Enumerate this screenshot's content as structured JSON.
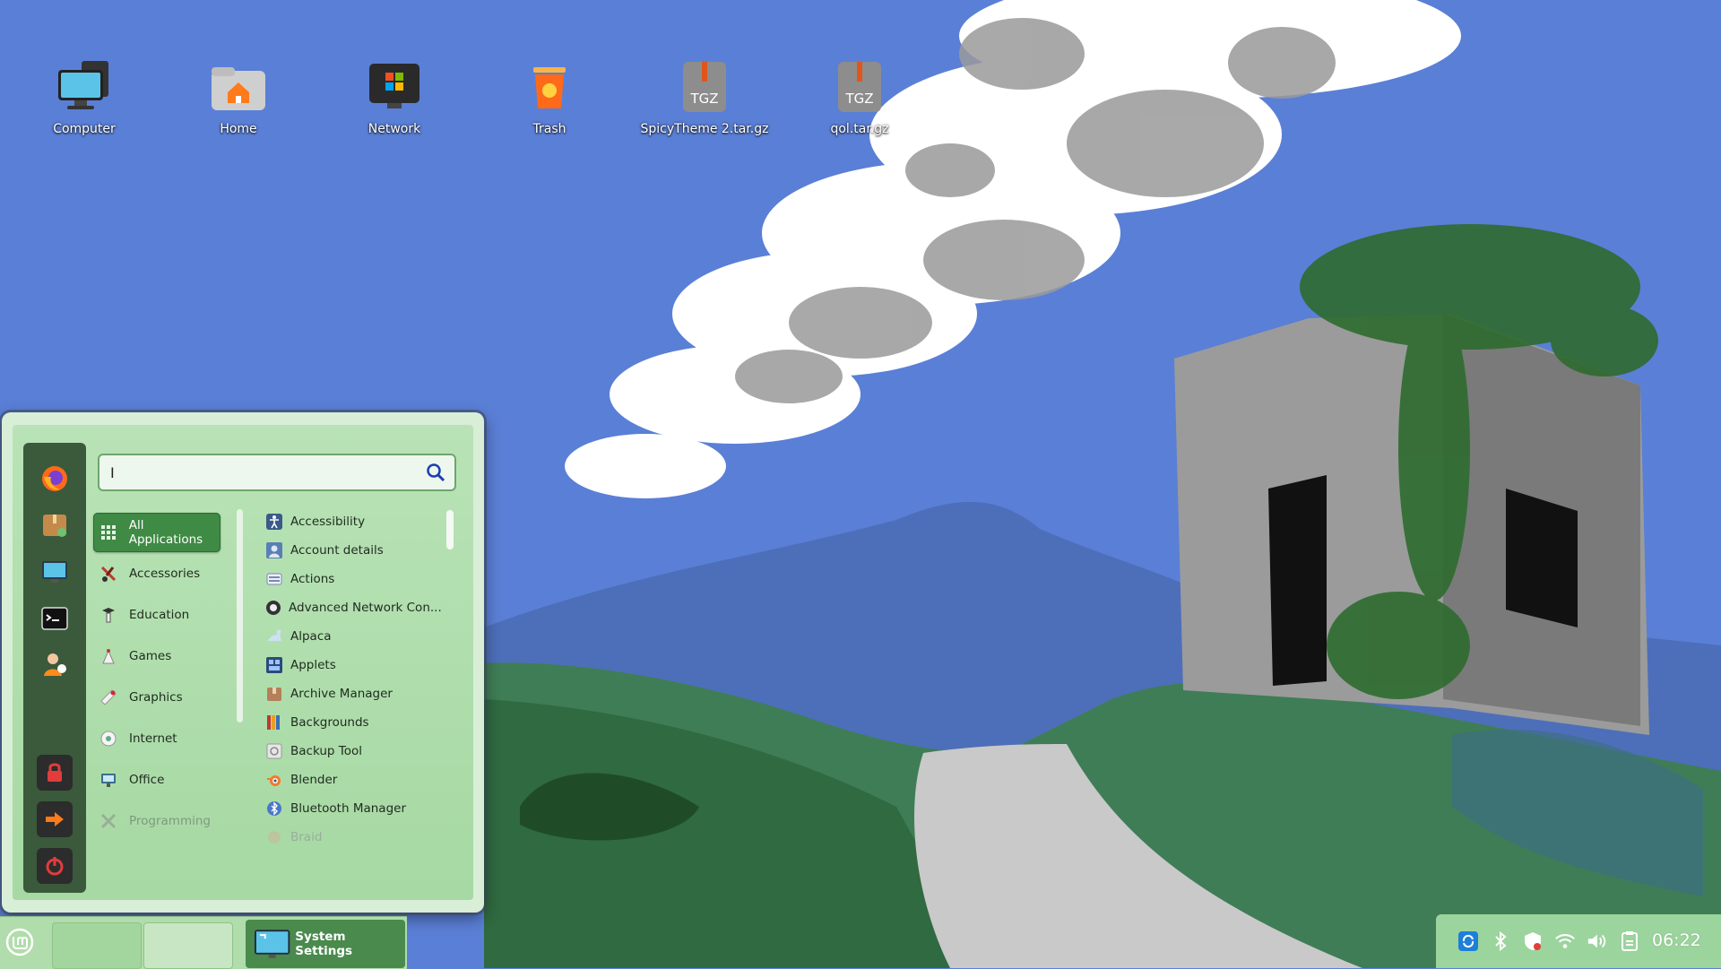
{
  "desktop": {
    "icons": [
      {
        "label": "Computer",
        "icon": "computer-icon"
      },
      {
        "label": "Home",
        "icon": "home-folder-icon"
      },
      {
        "label": "Network",
        "icon": "network-icon"
      },
      {
        "label": "Trash",
        "icon": "trash-icon"
      },
      {
        "label": "SpicyTheme 2.tar.gz",
        "icon": "archive-icon",
        "badge": "TGZ"
      },
      {
        "label": "qol.tar.gz",
        "icon": "archive-icon",
        "badge": "TGZ"
      }
    ]
  },
  "menu": {
    "search": {
      "value": "",
      "placeholder": "I"
    },
    "favorites": [
      "firefox-icon",
      "package-manager-icon",
      "system-settings-icon",
      "terminal-icon",
      "file-manager-icon",
      "lock-screen-icon",
      "logout-icon",
      "shutdown-icon"
    ],
    "categories": [
      {
        "label": "All Applications",
        "icon": "grid-icon",
        "active": true
      },
      {
        "label": "Accessories",
        "icon": "scissors-icon"
      },
      {
        "label": "Education",
        "icon": "education-icon"
      },
      {
        "label": "Games",
        "icon": "games-icon"
      },
      {
        "label": "Graphics",
        "icon": "graphics-icon"
      },
      {
        "label": "Internet",
        "icon": "internet-icon"
      },
      {
        "label": "Office",
        "icon": "office-icon"
      },
      {
        "label": "Programming",
        "icon": "programming-icon",
        "dim": true
      }
    ],
    "apps": [
      {
        "label": "Accessibility",
        "icon": "accessibility-icon"
      },
      {
        "label": "Account details",
        "icon": "account-icon"
      },
      {
        "label": "Actions",
        "icon": "actions-icon"
      },
      {
        "label": "Advanced Network Con...",
        "icon": "network-config-icon"
      },
      {
        "label": "Alpaca",
        "icon": "alpaca-icon"
      },
      {
        "label": "Applets",
        "icon": "applets-icon"
      },
      {
        "label": "Archive Manager",
        "icon": "archive-manager-icon"
      },
      {
        "label": "Backgrounds",
        "icon": "backgrounds-icon"
      },
      {
        "label": "Backup Tool",
        "icon": "backup-icon"
      },
      {
        "label": "Blender",
        "icon": "blender-icon"
      },
      {
        "label": "Bluetooth Manager",
        "icon": "bluetooth-icon"
      },
      {
        "label": "Braid",
        "icon": "braid-icon",
        "dim": true
      }
    ]
  },
  "panel": {
    "task": {
      "label": "System Settings",
      "icon": "system-settings-icon"
    },
    "tray": [
      "update-manager-icon",
      "bluetooth-icon",
      "shield-icon",
      "wifi-icon",
      "volume-icon",
      "clipboard-icon"
    ],
    "clock": "06:22"
  }
}
